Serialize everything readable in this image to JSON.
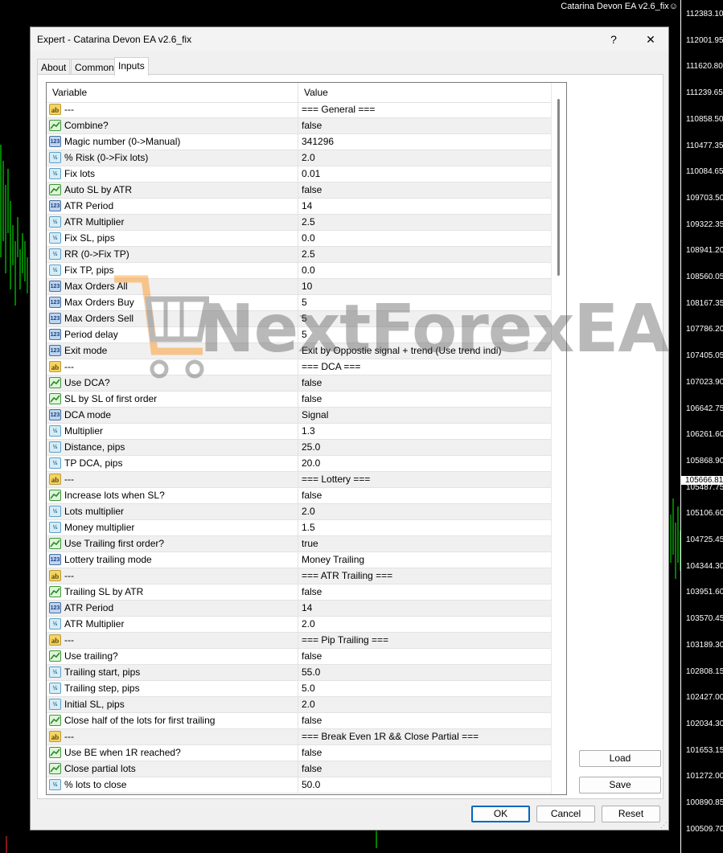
{
  "chart": {
    "title": "Catarina Devon EA v2.6_fix☺",
    "prices": [
      "112383.10",
      "112001.95",
      "111620.80",
      "111239.65",
      "110858.50",
      "110477.35",
      "110084.65",
      "109703.50",
      "109322.35",
      "108941.20",
      "108560.05",
      "108167.35",
      "107786.20",
      "107405.05",
      "107023.90",
      "106642.75",
      "106261.60",
      "105868.90",
      "105487.75",
      "105106.60",
      "104725.45",
      "104344.30",
      "103951.60",
      "103570.45",
      "103189.30",
      "102808.15",
      "102427.00",
      "102034.30",
      "101653.15",
      "101272.00",
      "100890.85",
      "100509.70"
    ],
    "current_price": "105666.81"
  },
  "dialog": {
    "title": "Expert - Catarina Devon EA v2.6_fix",
    "help_label": "?",
    "close_label": "✕",
    "tabs": [
      {
        "label": "About"
      },
      {
        "label": "Common"
      },
      {
        "label": "Inputs"
      }
    ],
    "active_tab": "Inputs",
    "grid": {
      "header_variable": "Variable",
      "header_value": "Value"
    },
    "inputs": [
      {
        "type": "ab",
        "variable": "---",
        "value": "=== General ==="
      },
      {
        "type": "bool",
        "variable": "Combine?",
        "value": "false"
      },
      {
        "type": "int",
        "variable": "Magic number (0->Manual)",
        "value": "341296"
      },
      {
        "type": "dbl",
        "variable": "% Risk (0->Fix lots)",
        "value": "2.0"
      },
      {
        "type": "dbl",
        "variable": "Fix lots",
        "value": "0.01"
      },
      {
        "type": "bool",
        "variable": "Auto SL by ATR",
        "value": "false"
      },
      {
        "type": "int",
        "variable": "ATR Period",
        "value": "14"
      },
      {
        "type": "dbl",
        "variable": "ATR Multiplier",
        "value": "2.5"
      },
      {
        "type": "dbl",
        "variable": "Fix SL, pips",
        "value": "0.0"
      },
      {
        "type": "dbl",
        "variable": "RR (0->Fix TP)",
        "value": "2.5"
      },
      {
        "type": "dbl",
        "variable": "Fix TP, pips",
        "value": "0.0"
      },
      {
        "type": "int",
        "variable": "Max Orders All",
        "value": "10"
      },
      {
        "type": "int",
        "variable": "Max Orders Buy",
        "value": "5"
      },
      {
        "type": "int",
        "variable": "Max Orders Sell",
        "value": "5"
      },
      {
        "type": "int",
        "variable": "Period delay",
        "value": "5"
      },
      {
        "type": "int",
        "variable": "Exit mode",
        "value": "Exit by Oppostie signal + trend (Use trend indi)"
      },
      {
        "type": "ab",
        "variable": "---",
        "value": "=== DCA ==="
      },
      {
        "type": "bool",
        "variable": "Use DCA?",
        "value": "false"
      },
      {
        "type": "bool",
        "variable": "SL by SL of first order",
        "value": "false"
      },
      {
        "type": "int",
        "variable": "DCA mode",
        "value": "Signal"
      },
      {
        "type": "dbl",
        "variable": "Multiplier",
        "value": "1.3"
      },
      {
        "type": "dbl",
        "variable": "Distance, pips",
        "value": "25.0"
      },
      {
        "type": "dbl",
        "variable": "TP DCA, pips",
        "value": "20.0"
      },
      {
        "type": "ab",
        "variable": "---",
        "value": "=== Lottery ==="
      },
      {
        "type": "bool",
        "variable": "Increase lots when SL?",
        "value": "false"
      },
      {
        "type": "dbl",
        "variable": "Lots multiplier",
        "value": "2.0"
      },
      {
        "type": "dbl",
        "variable": "Money multiplier",
        "value": "1.5"
      },
      {
        "type": "bool",
        "variable": "Use Trailing first order?",
        "value": "true"
      },
      {
        "type": "int",
        "variable": "Lottery trailing mode",
        "value": "Money Trailing"
      },
      {
        "type": "ab",
        "variable": "---",
        "value": "=== ATR Trailing ==="
      },
      {
        "type": "bool",
        "variable": "Trailing SL by ATR",
        "value": "false"
      },
      {
        "type": "int",
        "variable": "ATR Period",
        "value": "14"
      },
      {
        "type": "dbl",
        "variable": "ATR Multiplier",
        "value": "2.0"
      },
      {
        "type": "ab",
        "variable": "---",
        "value": "=== Pip Trailing ==="
      },
      {
        "type": "bool",
        "variable": "Use trailing?",
        "value": "false"
      },
      {
        "type": "dbl",
        "variable": "Trailing start, pips",
        "value": "55.0"
      },
      {
        "type": "dbl",
        "variable": "Trailing step, pips",
        "value": "5.0"
      },
      {
        "type": "dbl",
        "variable": "Initial SL, pips",
        "value": "2.0"
      },
      {
        "type": "bool",
        "variable": "Close half of the lots for first trailing",
        "value": "false"
      },
      {
        "type": "ab",
        "variable": "---",
        "value": "=== Break Even 1R && Close Partial ==="
      },
      {
        "type": "bool",
        "variable": "Use BE when 1R reached?",
        "value": "false"
      },
      {
        "type": "bool",
        "variable": "Close partial lots",
        "value": "false"
      },
      {
        "type": "dbl",
        "variable": "% lots to close",
        "value": "50.0"
      }
    ],
    "icon_glyphs": {
      "ab": "ab",
      "bool": "",
      "int": "123",
      "dbl": "½"
    },
    "buttons": {
      "load": "Load",
      "save": "Save",
      "ok": "OK",
      "cancel": "Cancel",
      "reset": "Reset"
    }
  },
  "watermark": {
    "text": "NextForexEA"
  }
}
